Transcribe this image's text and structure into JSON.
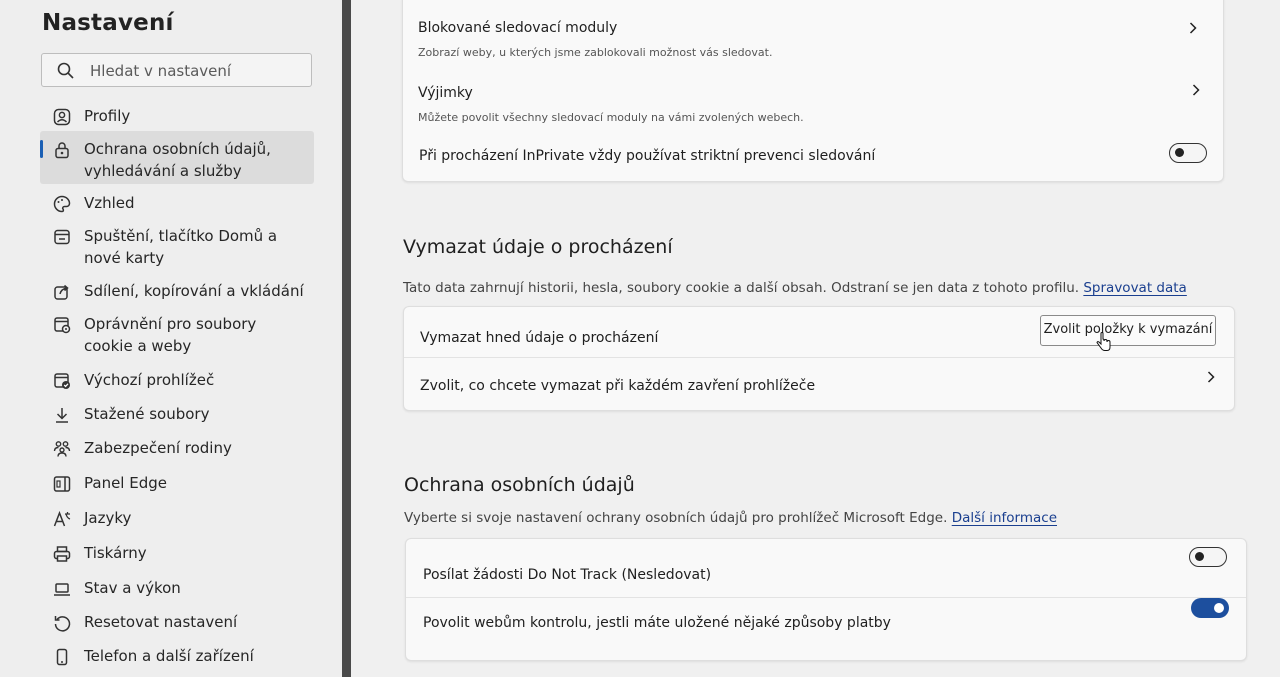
{
  "sidebar": {
    "title": "Nastavení",
    "search_placeholder": "Hledat v nastavení",
    "items": [
      {
        "label": "Profily",
        "icon": "profile-icon"
      },
      {
        "label": "Ochrana osobních údajů, vyhledávání a služby",
        "icon": "lock-icon",
        "active": true
      },
      {
        "label": "Vzhled",
        "icon": "appearance-icon"
      },
      {
        "label": "Spuštění, tlačítko Domů a nové karty",
        "icon": "startup-icon"
      },
      {
        "label": "Sdílení, kopírování a vkládání",
        "icon": "share-icon"
      },
      {
        "label": "Oprávnění pro soubory cookie a weby",
        "icon": "cookie-icon"
      },
      {
        "label": "Výchozí prohlížeč",
        "icon": "browser-icon"
      },
      {
        "label": "Stažené soubory",
        "icon": "download-icon"
      },
      {
        "label": "Zabezpečení rodiny",
        "icon": "family-icon"
      },
      {
        "label": "Panel Edge",
        "icon": "panel-icon"
      },
      {
        "label": "Jazyky",
        "icon": "language-icon"
      },
      {
        "label": "Tiskárny",
        "icon": "printer-icon"
      },
      {
        "label": "Stav a výkon",
        "icon": "laptop-icon"
      },
      {
        "label": "Resetovat nastavení",
        "icon": "reset-icon"
      },
      {
        "label": "Telefon a další zařízení",
        "icon": "phone-icon"
      }
    ]
  },
  "tracking": {
    "blocked_title": "Blokované sledovací moduly",
    "blocked_desc": "Zobrazí weby, u kterých jsme zablokovali možnost vás sledovat.",
    "exceptions_title": "Výjimky",
    "exceptions_desc": "Můžete povolit všechny sledovací moduly na vámi zvolených webech.",
    "inprivate_label": "Při procházení InPrivate vždy používat striktní prevenci sledování",
    "inprivate_on": false
  },
  "clear": {
    "title": "Vymazat údaje o procházení",
    "desc": "Tato data zahrnují historii, hesla, soubory cookie a další obsah. Odstraní se jen data z tohoto profilu.",
    "link": "Spravovat data",
    "now_label": "Vymazat hned údaje o procházení",
    "button": "Zvolit položky k vymazání",
    "on_close_label": "Zvolit, co chcete vymazat při každém zavření prohlížeče"
  },
  "privacy": {
    "title": "Ochrana osobních údajů",
    "desc": "Vyberte si svoje nastavení ochrany osobních údajů pro prohlížeč Microsoft Edge.",
    "link": "Další informace",
    "dnt_label": "Posílat žádosti Do Not Track (Nesledovat)",
    "dnt_on": false,
    "payment_label": "Povolit webům kontrolu, jestli máte uložené nějaké způsoby platby",
    "payment_on": true
  },
  "colors": {
    "accent": "#1d4f9e",
    "link": "#1a3f8f",
    "divider": "#4a4a4a"
  }
}
